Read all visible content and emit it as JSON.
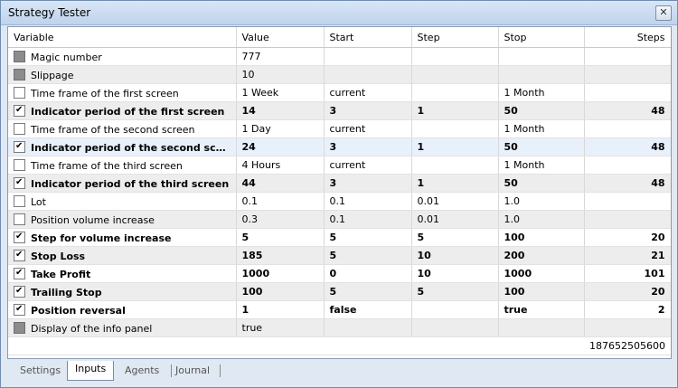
{
  "window": {
    "title": "Strategy Tester",
    "close_glyph": "✕"
  },
  "columns": [
    "Variable",
    "Value",
    "Start",
    "Step",
    "Stop",
    "Steps"
  ],
  "rows": [
    {
      "variable": "Magic number",
      "value": "777",
      "start": "",
      "step": "",
      "stop": "",
      "steps": "",
      "checked": false,
      "disabled": true,
      "bold": false
    },
    {
      "variable": "Slippage",
      "value": "10",
      "start": "",
      "step": "",
      "stop": "",
      "steps": "",
      "checked": false,
      "disabled": true,
      "bold": false
    },
    {
      "variable": "Time frame of the first screen",
      "value": "1 Week",
      "start": "current",
      "step": "",
      "stop": "1 Month",
      "steps": "",
      "checked": false,
      "disabled": false,
      "bold": false
    },
    {
      "variable": "Indicator period of the first screen",
      "value": "14",
      "start": "3",
      "step": "1",
      "stop": "50",
      "steps": "48",
      "checked": true,
      "disabled": false,
      "bold": true
    },
    {
      "variable": "Time frame of the second screen",
      "value": "1 Day",
      "start": "current",
      "step": "",
      "stop": "1 Month",
      "steps": "",
      "checked": false,
      "disabled": false,
      "bold": false
    },
    {
      "variable": "Indicator period of the second screen",
      "value": "24",
      "start": "3",
      "step": "1",
      "stop": "50",
      "steps": "48",
      "checked": true,
      "disabled": false,
      "bold": true
    },
    {
      "variable": "Time frame of the third screen",
      "value": "4 Hours",
      "start": "current",
      "step": "",
      "stop": "1 Month",
      "steps": "",
      "checked": false,
      "disabled": false,
      "bold": false
    },
    {
      "variable": "Indicator period of the third screen",
      "value": "44",
      "start": "3",
      "step": "1",
      "stop": "50",
      "steps": "48",
      "checked": true,
      "disabled": false,
      "bold": true
    },
    {
      "variable": "Lot",
      "value": "0.1",
      "start": "0.1",
      "step": "0.01",
      "stop": "1.0",
      "steps": "",
      "checked": false,
      "disabled": false,
      "bold": false
    },
    {
      "variable": "Position volume increase",
      "value": "0.3",
      "start": "0.1",
      "step": "0.01",
      "stop": "1.0",
      "steps": "",
      "checked": false,
      "disabled": false,
      "bold": false
    },
    {
      "variable": "Step for volume increase",
      "value": "5",
      "start": "5",
      "step": "5",
      "stop": "100",
      "steps": "20",
      "checked": true,
      "disabled": false,
      "bold": true
    },
    {
      "variable": "Stop Loss",
      "value": "185",
      "start": "5",
      "step": "10",
      "stop": "200",
      "steps": "21",
      "checked": true,
      "disabled": false,
      "bold": true
    },
    {
      "variable": "Take Profit",
      "value": "1000",
      "start": "0",
      "step": "10",
      "stop": "1000",
      "steps": "101",
      "checked": true,
      "disabled": false,
      "bold": true
    },
    {
      "variable": "Trailing Stop",
      "value": "100",
      "start": "5",
      "step": "5",
      "stop": "100",
      "steps": "20",
      "checked": true,
      "disabled": false,
      "bold": true
    },
    {
      "variable": "Position reversal",
      "value": "1",
      "start": "false",
      "step": "",
      "stop": "true",
      "steps": "2",
      "checked": true,
      "disabled": false,
      "bold": true
    },
    {
      "variable": "Display of the info panel",
      "value": "true",
      "start": "",
      "step": "",
      "stop": "",
      "steps": "",
      "checked": false,
      "disabled": true,
      "bold": false
    }
  ],
  "total_steps": "187652505600",
  "tabs": [
    "Settings",
    "Inputs",
    "Agents",
    "Journal"
  ],
  "active_tab": "Inputs",
  "colors": {
    "row_alt": "#ededed",
    "row_selected": "#e8f0fb",
    "title_bar": "#c9dbf0"
  }
}
